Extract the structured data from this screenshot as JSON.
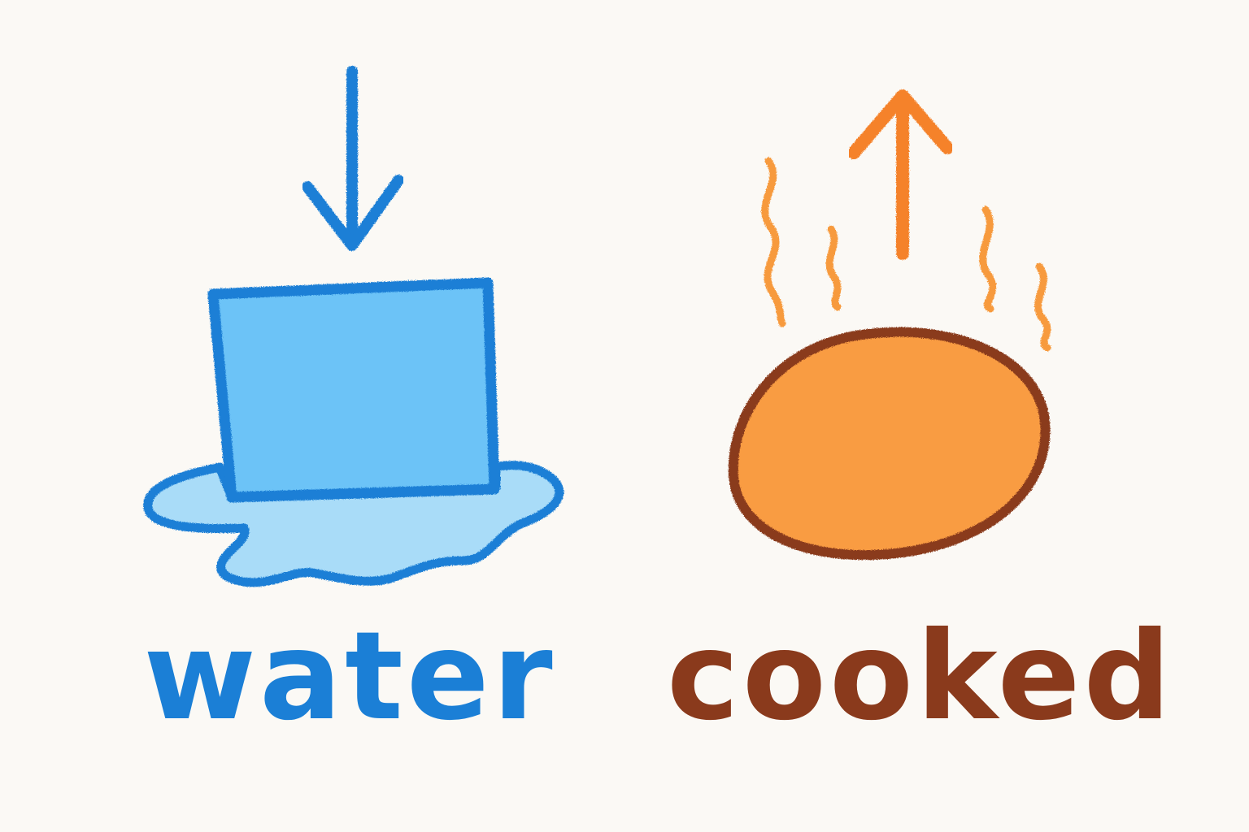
{
  "labels": {
    "water": "water",
    "cooked": "cooked"
  },
  "colors": {
    "background": "#fbf9f5",
    "water_blue": "#1b7fd6",
    "water_fill": "#6cc3f7",
    "puddle_fill": "#a9dcf8",
    "heat_orange": "#f5822a",
    "steam_orange": "#f79a3c",
    "egg_fill": "#f99c42",
    "cooked_brown": "#8a3a1c"
  },
  "icons": {
    "down_arrow": "down-arrow-icon",
    "ice_cube": "ice-cube-icon",
    "puddle": "puddle-icon",
    "up_arrow": "up-arrow-icon",
    "steam": "steam-icon",
    "egg": "egg-icon"
  }
}
